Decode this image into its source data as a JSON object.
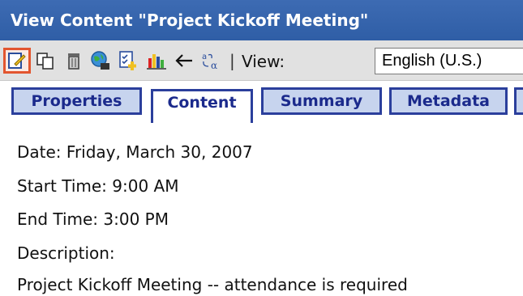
{
  "window": {
    "title": "View Content \"Project Kickoff Meeting\""
  },
  "toolbar": {
    "icons": [
      "edit-icon",
      "copy-icon",
      "delete-icon",
      "globe-icon",
      "checklist-add-icon",
      "chart-icon",
      "back-arrow-icon",
      "translate-icon"
    ],
    "separator": "|",
    "view_label": "View:",
    "language_selected": "English (U.S.)"
  },
  "tabs": [
    {
      "label": "Properties",
      "active": false
    },
    {
      "label": "Content",
      "active": true
    },
    {
      "label": "Summary",
      "active": false
    },
    {
      "label": "Metadata",
      "active": false
    }
  ],
  "content": {
    "date": "Date: Friday, March 30, 2007",
    "start_time": "Start Time: 9:00 AM",
    "end_time": "End Time: 3:00 PM",
    "description_label": "Description:",
    "description": "Project Kickoff Meeting -- attendance is required"
  },
  "colors": {
    "titlebar": "#2f5ea6",
    "tab_border": "#2b3f9c",
    "tab_fill": "#c7d4ee",
    "selected_icon_border": "#e2552f"
  }
}
